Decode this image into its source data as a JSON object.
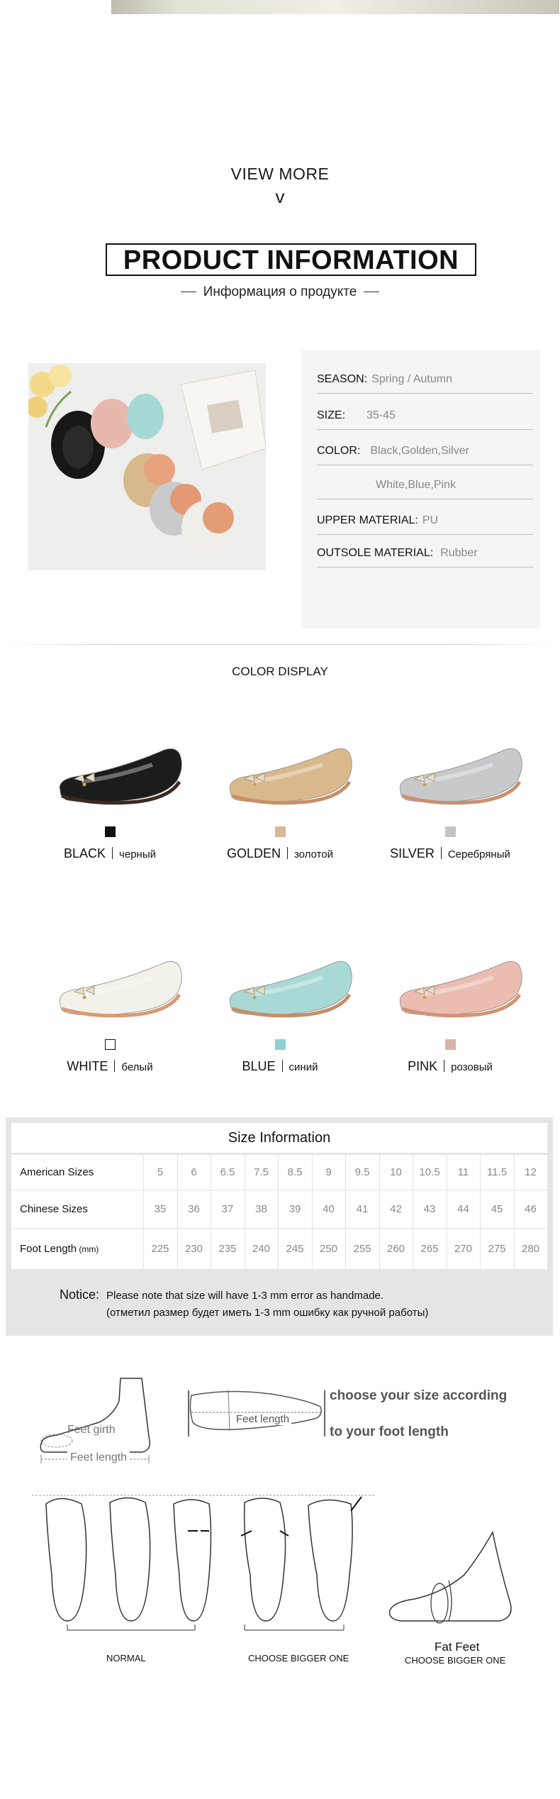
{
  "view_more": {
    "label": "VIEW MORE",
    "chevron": "v"
  },
  "product_info": {
    "title": "PRODUCT INFORMATION",
    "subtitle": "Информация о продукте"
  },
  "specs": [
    {
      "label": "SEASON:",
      "value": "Spring / Autumn"
    },
    {
      "label": "SIZE:",
      "value": "35-45"
    },
    {
      "label": "COLOR:",
      "value": "Black,Golden,Silver"
    },
    {
      "label": "",
      "value": "White,Blue,Pink"
    },
    {
      "label": "UPPER MATERIAL:",
      "value": "PU"
    },
    {
      "label": "OUTSOLE MATERIAL:",
      "value": "Rubber"
    }
  ],
  "color_display": {
    "title": "COLOR DISPLAY",
    "colors": [
      {
        "en": "BLACK",
        "ru": "черный",
        "swatch": "#111111",
        "shoe": "#1c1c1c",
        "sole": "#3a2a22"
      },
      {
        "en": "GOLDEN",
        "ru": "золотой",
        "swatch": "#d8b896",
        "shoe": "#d9b98c",
        "sole": "#c98f66"
      },
      {
        "en": "SILVER",
        "ru": "Серебряный",
        "swatch": "#c4c4c4",
        "shoe": "#c7c9cb",
        "sole": "#c99070"
      },
      {
        "en": "WHITE",
        "ru": "белый",
        "swatch": "#ffffff",
        "shoe": "#f2f1ea",
        "sole": "#d89a72"
      },
      {
        "en": "BLUE",
        "ru": "синий",
        "swatch": "#8fd0d0",
        "shoe": "#a9d9d4",
        "sole": "#c98c68"
      },
      {
        "en": "PINK",
        "ru": "розовый",
        "swatch": "#d9b3a6",
        "shoe": "#ebbdb1",
        "sole": "#d09474"
      }
    ]
  },
  "size_info": {
    "title": "Size Information",
    "rows": [
      {
        "label": "American Sizes",
        "values": [
          "5",
          "6",
          "6.5",
          "7.5",
          "8.5",
          "9",
          "9.5",
          "10",
          "10.5",
          "11",
          "11.5",
          "12"
        ]
      },
      {
        "label": "Chinese Sizes",
        "values": [
          "35",
          "36",
          "37",
          "38",
          "39",
          "40",
          "41",
          "42",
          "43",
          "44",
          "45",
          "46"
        ]
      },
      {
        "label": "Foot Length",
        "unit": "(mm)",
        "values": [
          "225",
          "230",
          "235",
          "240",
          "245",
          "250",
          "255",
          "260",
          "265",
          "270",
          "275",
          "280"
        ]
      }
    ],
    "notice_label": "Notice:",
    "notice_text": "Please note that size will have 1-3 mm error as handmade.",
    "notice_ru": "(отметил размер будет иметь 1-3 mm ошибку как ручной работы)"
  },
  "measure": {
    "feet_girth": "Feet girth",
    "feet_length": "Feet length",
    "feet_length_2": "Feet length",
    "line1": "choose your size according",
    "line2": "to your foot length",
    "normal": "NORMAL",
    "bigger1": "CHOOSE BIGGER ONE",
    "fat_feet": "Fat  Feet",
    "bigger2": "CHOOSE BIGGER ONE"
  }
}
